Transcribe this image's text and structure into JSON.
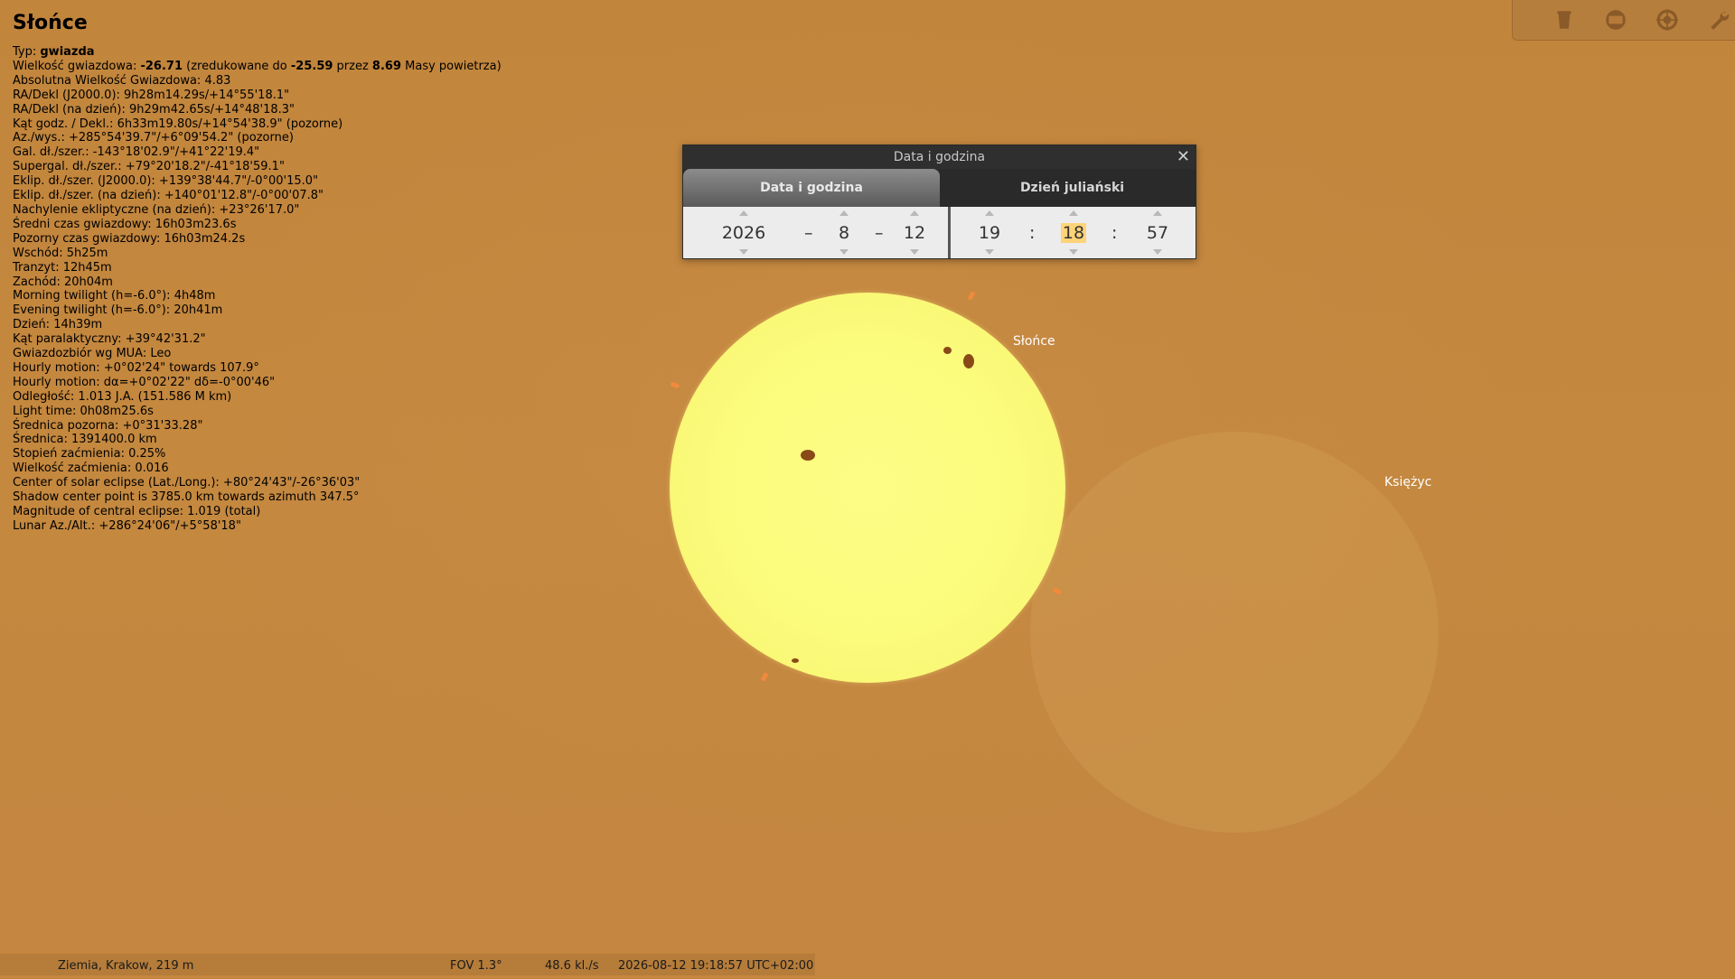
{
  "object": {
    "title": "Słońce",
    "lines": [
      {
        "label": "Typ: ",
        "value": "gwiazda",
        "bold": true
      },
      {
        "label": "Wielkość gwiazdowa: ",
        "value": "-26.71",
        "bold": true,
        "rest": " (zredukowane do ",
        "value2": "-25.59",
        "rest2": " przez ",
        "value3": "8.69",
        "rest3": " Masy powietrza)"
      },
      {
        "text": "Absolutna Wielkość Gwiazdowa: 4.83"
      },
      {
        "text": "RA/Dekl (J2000.0): 9h28m14.29s/+14°55'18.1\""
      },
      {
        "text": "RA/Dekl (na dzień): 9h29m42.65s/+14°48'18.3\""
      },
      {
        "text": "Kąt godz. / Dekl.: 6h33m19.80s/+14°54'38.9\" (pozorne)"
      },
      {
        "text": "Az./wys.: +285°54'39.7\"/+6°09'54.2\" (pozorne)"
      },
      {
        "text": "Gal. dł./szer.: -143°18'02.9\"/+41°22'19.4\""
      },
      {
        "text": "Supergal. dł./szer.: +79°20'18.2\"/-41°18'59.1\""
      },
      {
        "text": "Eklip. dł./szer. (J2000.0): +139°38'44.7\"/-0°00'15.0\""
      },
      {
        "text": "Eklip. dł./szer. (na dzień): +140°01'12.8\"/-0°00'07.8\""
      },
      {
        "text": "Nachylenie ekliptyczne (na dzień): +23°26'17.0\""
      },
      {
        "text": "Średni czas gwiazdowy: 16h03m23.6s"
      },
      {
        "text": "Pozorny czas gwiazdowy: 16h03m24.2s"
      },
      {
        "text": "Wschód: 5h25m"
      },
      {
        "text": "Tranzyt: 12h45m"
      },
      {
        "text": "Zachód: 20h04m"
      },
      {
        "text": "Morning twilight (h=-6.0°): 4h48m"
      },
      {
        "text": "Evening twilight (h=-6.0°): 20h41m"
      },
      {
        "text": "Dzień: 14h39m"
      },
      {
        "text": "Kąt paralaktyczny: +39°42'31.2\""
      },
      {
        "text": "Gwiazdozbiór wg MUA: Leo"
      },
      {
        "text": "Hourly motion: +0°02'24\" towards 107.9°"
      },
      {
        "text": "Hourly motion: dα=+0°02'22\" dδ=-0°00'46\""
      },
      {
        "text": "Odległość: 1.013 J.A. (151.586 M km)"
      },
      {
        "text": "Light time: 0h08m25.6s"
      },
      {
        "text": "Średnica pozorna: +0°31'33.28\""
      },
      {
        "text": "Średnica: 1391400.0 km"
      },
      {
        "text": "Stopień zaćmienia: 0.25%"
      },
      {
        "text": "Wielkość zaćmienia: 0.016"
      },
      {
        "text": "Center of solar eclipse (Lat./Long.): +80°24'43\"/-26°36'03\""
      },
      {
        "text": "Shadow center point is 3785.0 km towards azimuth 347.5°"
      },
      {
        "text": "Magnitude of central eclipse: 1.019 (total)"
      },
      {
        "text": "Lunar Az./Alt.: +286°24'06\"/+5°58'18\""
      }
    ]
  },
  "sky_labels": {
    "sun": "Słońce",
    "moon": "Księżyc"
  },
  "dialog": {
    "title": "Data i godzina",
    "close_glyph": "✕",
    "tabs": [
      "Data i godzina",
      "Dzień juliański"
    ],
    "year": "2026",
    "month": "8",
    "day": "12",
    "hour": "19",
    "minute": "18",
    "second": "57",
    "date_sep": "–",
    "time_sep": ":"
  },
  "toolbar": {
    "icons": [
      "trash-icon",
      "window-icon",
      "target-icon",
      "wrench-icon"
    ]
  },
  "status": {
    "location": "Ziemia, Krakow, 219 m",
    "fov": "FOV 1.3°",
    "fps": "48.6 kl./s",
    "datetime": "2026-08-12 19:18:57 UTC+02:00"
  },
  "colors": {
    "sky": "#c4873e",
    "sun": "#fbfb7c",
    "highlight": "#ffd478"
  }
}
